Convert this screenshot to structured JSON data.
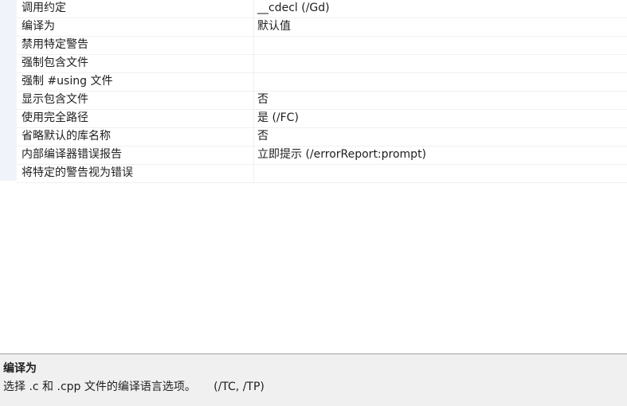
{
  "properties": [
    {
      "name": "调用约定",
      "value": "__cdecl (/Gd)"
    },
    {
      "name": "编译为",
      "value": "默认值"
    },
    {
      "name": "禁用特定警告",
      "value": ""
    },
    {
      "name": "强制包含文件",
      "value": ""
    },
    {
      "name": "强制 #using 文件",
      "value": ""
    },
    {
      "name": "显示包含文件",
      "value": "否"
    },
    {
      "name": "使用完全路径",
      "value": "是 (/FC)"
    },
    {
      "name": "省略默认的库名称",
      "value": "否"
    },
    {
      "name": "内部编译器错误报告",
      "value": "立即提示 (/errorReport:prompt)"
    },
    {
      "name": "将特定的警告视为错误",
      "value": ""
    }
  ],
  "description": {
    "title": "编译为",
    "text": "选择 .c 和 .cpp 文件的编译语言选项。     (/TC, /TP)"
  }
}
